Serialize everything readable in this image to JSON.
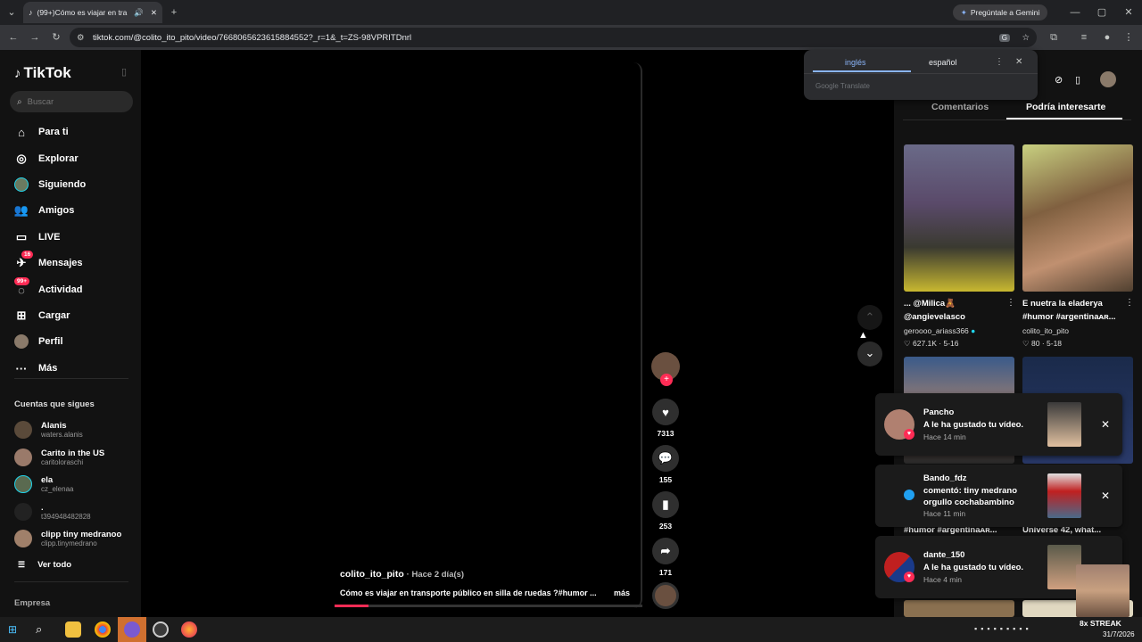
{
  "browser": {
    "tab_title": "(99+)Cómo es viajar en tra",
    "url": "tiktok.com/@colito_ito_pito/video/7668065623615884552?_r=1&_t=ZS-98VPRITDnrl",
    "gemini_label": "Pregúntale a Gemini"
  },
  "translate": {
    "lang_from": "inglés",
    "lang_to": "español",
    "provider": "Google Translate"
  },
  "sidebar": {
    "logo": "TikTok",
    "search_placeholder": "Buscar",
    "nav": [
      {
        "label": "Para ti"
      },
      {
        "label": "Explorar"
      },
      {
        "label": "Siguiendo"
      },
      {
        "label": "Amigos"
      },
      {
        "label": "LIVE"
      },
      {
        "label": "Mensajes",
        "badge": "16"
      },
      {
        "label": "Actividad",
        "badge": "99+"
      },
      {
        "label": "Cargar"
      },
      {
        "label": "Perfil"
      },
      {
        "label": "Más"
      }
    ],
    "following_title": "Cuentas que sigues",
    "following": [
      {
        "name": "Alanis",
        "handle": "waters.alanis"
      },
      {
        "name": "Carito in the US",
        "handle": "caritoloraschi"
      },
      {
        "name": "ela",
        "handle": "cz_elenaa"
      },
      {
        "name": ".",
        "handle": "t394948482828"
      },
      {
        "name": "clipp tiny medranoo",
        "handle": "clipp.tinymedrano"
      }
    ],
    "see_all": "Ver todo",
    "company": "Empresa"
  },
  "video": {
    "author": "colito_ito_pito",
    "time_ago": "· Hace 2 día(s)",
    "caption": "Cómo es viajar en transporte público en silla de ruedas ?#humor ...",
    "more": "más",
    "likes": "7313",
    "comments": "155",
    "saves": "253",
    "shares": "171"
  },
  "right_panel": {
    "tab_comments": "Comentarios",
    "tab_suggested": "Podría interesarte",
    "cards": [
      {
        "title1": "... @Milica🧸",
        "title2": "@angievelasco",
        "author": "geroooo_ariass366",
        "likes": "627.1K",
        "date": "5-16"
      },
      {
        "title1": "E nuetra la eladerya",
        "title2": "#humor #argentinaᴀʀ...",
        "author": "colito_ito_pito",
        "likes": "80",
        "date": "5-18"
      }
    ],
    "partial_left": "#humor #argentinaᴀʀ...",
    "partial_right": "Universe 42, what..."
  },
  "notifications": [
    {
      "name": "Pancho",
      "text": "A le ha gustado tu vídeo.",
      "time": "Hace 14 min"
    },
    {
      "name": "Bando_fdz",
      "text": "comentó: tiny medrano orgullo cochabambino",
      "time": "Hace 11 min"
    },
    {
      "name": "dante_150",
      "text": "A le ha gustado tu vídeo.",
      "time": "Hace 4 min"
    }
  ],
  "taskbar": {
    "date": "31/7/2026",
    "streak": "8x STREAK"
  },
  "colors": {
    "accent": "#fe2c55",
    "bg": "#121212"
  }
}
